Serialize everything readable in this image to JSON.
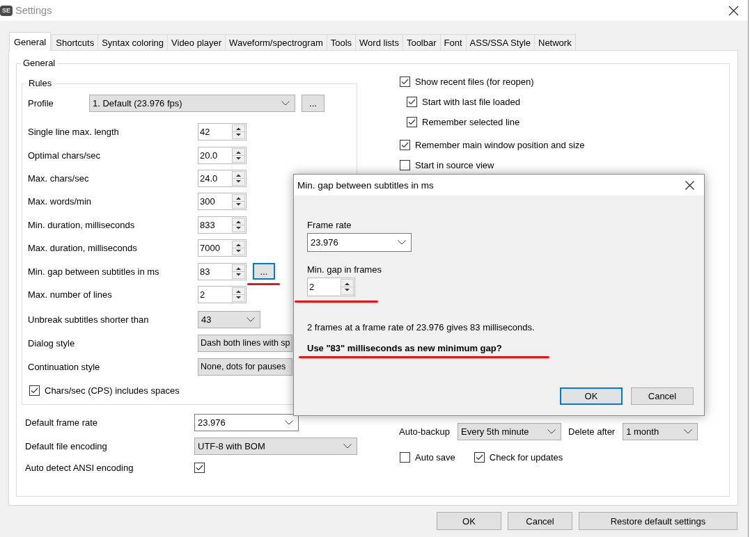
{
  "window": {
    "logo": "SE",
    "title": "Settings"
  },
  "tabs": [
    {
      "label": "General",
      "selected": true
    },
    {
      "label": "Shortcuts",
      "selected": false
    },
    {
      "label": "Syntax coloring",
      "selected": false
    },
    {
      "label": "Video player",
      "selected": false
    },
    {
      "label": "Waveform/spectrogram",
      "selected": false
    },
    {
      "label": "Tools",
      "selected": false
    },
    {
      "label": "Word lists",
      "selected": false
    },
    {
      "label": "Toolbar",
      "selected": false
    },
    {
      "label": "Font",
      "selected": false
    },
    {
      "label": "ASS/SSA Style",
      "selected": false
    },
    {
      "label": "Network",
      "selected": false
    }
  ],
  "general": {
    "title": "General",
    "rules": {
      "title": "Rules",
      "profile": {
        "label": "Profile",
        "value": "1. Default (23.976 fps)",
        "button": "..."
      },
      "fields": [
        {
          "kind": "spin",
          "label": "Single line max. length",
          "value": "42"
        },
        {
          "kind": "spin",
          "label": "Optimal chars/sec",
          "value": "20.0"
        },
        {
          "kind": "spin",
          "label": "Max. chars/sec",
          "value": "24.0"
        },
        {
          "kind": "spin",
          "label": "Max. words/min",
          "value": "300"
        },
        {
          "kind": "spin",
          "label": "Min. duration, milliseconds",
          "value": "833"
        },
        {
          "kind": "spin",
          "label": "Max. duration, milliseconds",
          "value": "7000"
        },
        {
          "kind": "spin",
          "label": "Min. gap between subtitles in ms",
          "value": "83",
          "button": "...",
          "focused": true,
          "underlined": true
        },
        {
          "kind": "spin",
          "label": "Max. number of lines",
          "value": "2"
        },
        {
          "kind": "dropdown",
          "label": "Unbreak subtitles shorter than",
          "value": "43"
        },
        {
          "kind": "dropdown",
          "label": "Dialog style",
          "value": "Dash both lines with sp"
        },
        {
          "kind": "dropdown",
          "label": "Continuation style",
          "value": "None, dots for pauses"
        }
      ],
      "cps_includes_spaces": {
        "label": "Chars/sec (CPS) includes spaces",
        "checked": true
      }
    },
    "defaults": [
      {
        "kind": "combo",
        "label": "Default frame rate",
        "value": "23.976"
      },
      {
        "kind": "dropdown",
        "label": "Default file encoding",
        "value": "UTF-8 with BOM"
      },
      {
        "kind": "checkbox",
        "label": "Auto detect ANSI encoding",
        "checked": true
      }
    ],
    "options": [
      {
        "label": "Show recent files (for reopen)",
        "checked": true,
        "children": [
          {
            "label": "Start with last file loaded",
            "checked": true
          },
          {
            "label": "Remember selected line",
            "checked": true
          }
        ]
      },
      {
        "label": "Remember main window position and size",
        "checked": true
      },
      {
        "label": "Start in source view",
        "checked": false
      }
    ],
    "auto_backup": {
      "label": "Auto-backup",
      "value": "Every 5th minute"
    },
    "delete_after": {
      "label": "Delete after",
      "value": "1 month"
    },
    "bottom_checks": [
      {
        "label": "Auto save",
        "checked": false
      },
      {
        "label": "Check for updates",
        "checked": true
      }
    ]
  },
  "buttons": [
    {
      "label": "OK"
    },
    {
      "label": "Cancel"
    },
    {
      "label": "Restore default settings"
    }
  ],
  "dialog": {
    "title": "Min. gap between subtitles in ms",
    "frame_rate": {
      "label": "Frame rate",
      "value": "23.976"
    },
    "min_gap_frames": {
      "label": "Min. gap in frames",
      "value": "2",
      "underlined": true
    },
    "result": "2 frames at a frame rate of 23.976 gives 83 milliseconds.",
    "question": {
      "text": "Use \"83\" milliseconds as new minimum gap?",
      "underlined": true
    },
    "buttons": [
      {
        "label": "OK",
        "default": true
      },
      {
        "label": "Cancel",
        "default": false
      }
    ]
  }
}
